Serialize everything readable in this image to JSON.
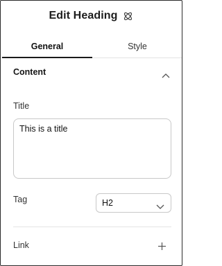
{
  "header": {
    "title": "Edit Heading",
    "icon": "atom-icon"
  },
  "tabs": [
    {
      "label": "General",
      "active": true
    },
    {
      "label": "Style",
      "active": false
    }
  ],
  "section": {
    "title": "Content",
    "expanded": true,
    "icon": "chevron-up-icon"
  },
  "fields": {
    "title": {
      "label": "Title",
      "value": "This is a title"
    },
    "tag": {
      "label": "Tag",
      "value": "H2",
      "icon": "chevron-down-icon"
    }
  },
  "link": {
    "label": "Link",
    "icon": "plus-icon"
  }
}
